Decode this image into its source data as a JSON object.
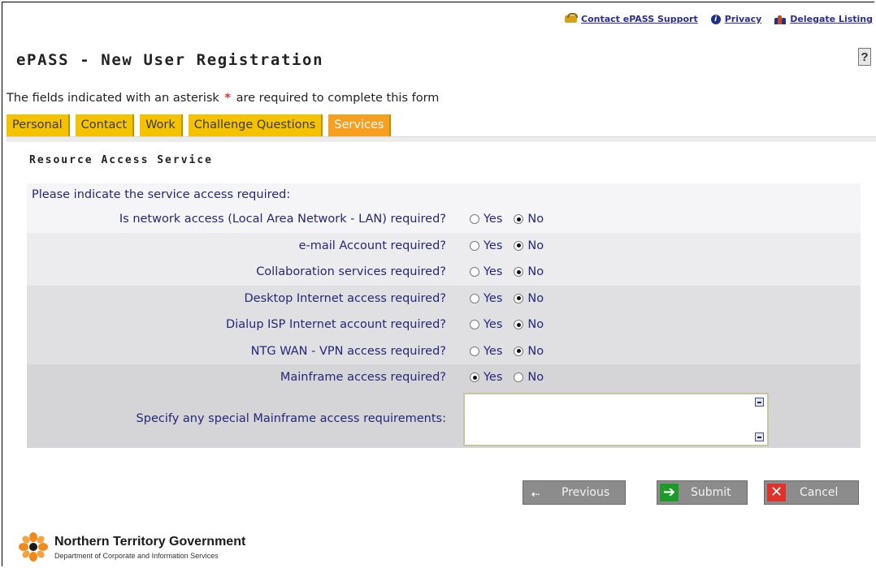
{
  "top_links": {
    "contact": "Contact ePASS Support",
    "privacy": "Privacy",
    "delegate": "Delegate Listing"
  },
  "page_title": "ePASS - New User Registration",
  "help": "?",
  "required_note": {
    "before": "The fields indicated with an asterisk",
    "star": "*",
    "after": "are required to complete this form"
  },
  "tabs": [
    "Personal",
    "Contact",
    "Work",
    "Challenge Questions",
    "Services"
  ],
  "active_tab": "Services",
  "section_title": "Resource Access Service",
  "intro": "Please indicate the service access required:",
  "options": {
    "yes": "Yes",
    "no": "No"
  },
  "questions": [
    {
      "label": "Is network access (Local Area Network - LAN) required?",
      "value": "No"
    },
    {
      "label": "e-mail Account required?",
      "value": "No"
    },
    {
      "label": "Collaboration services required?",
      "value": "No"
    },
    {
      "label": "Desktop Internet access required?",
      "value": "No"
    },
    {
      "label": "Dialup ISP Internet account required?",
      "value": "No"
    },
    {
      "label": "NTG WAN - VPN access required?",
      "value": "No"
    },
    {
      "label": "Mainframe access required?",
      "value": "Yes"
    }
  ],
  "mainframe_requirements": {
    "label": "Specify any special Mainframe access requirements:",
    "value": ""
  },
  "buttons": {
    "previous": "Previous",
    "submit": "Submit",
    "cancel": "Cancel"
  },
  "footer": {
    "org": "Northern Territory Government",
    "dept": "Department of Corporate and Information Services"
  },
  "colors": {
    "tab": "#f5c200",
    "tab_active": "#f79f20",
    "link": "#2d2d99",
    "label": "#26267a",
    "button": "#8c8c8c",
    "submit_icon": "#1e9a2a",
    "cancel_icon": "#e0312a"
  },
  "icons": {
    "contact": "phone-icon",
    "privacy": "info-icon",
    "delegate": "people-icon",
    "previous": "arrow-left-icon",
    "submit": "arrow-right-icon",
    "cancel": "x-icon",
    "logo": "sun-logo"
  }
}
